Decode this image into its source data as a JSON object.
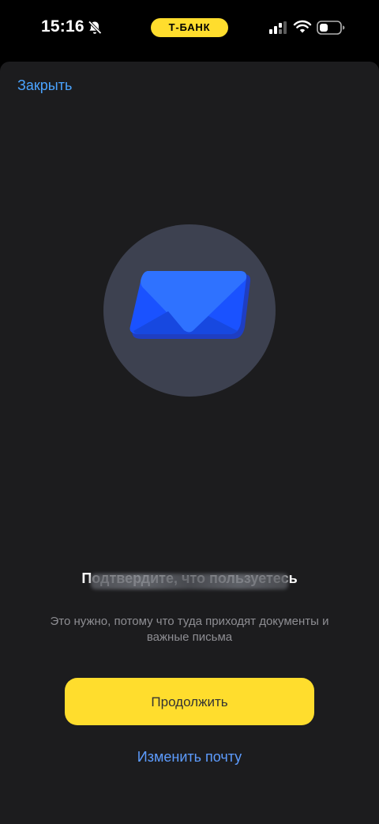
{
  "status_bar": {
    "time": "15:16",
    "carrier": "Т-БАНК",
    "icons": [
      "bell-slash-icon",
      "signal-icon",
      "wifi-icon",
      "battery-icon"
    ],
    "carrier_color": "#ffdd2d"
  },
  "header": {
    "close_label": "Закрыть"
  },
  "illustration": {
    "icon": "envelope-icon",
    "circle_color": "#3d4150",
    "envelope_color": "#1a52ff"
  },
  "content": {
    "title": "Подтвердите, что пользуетесь",
    "subtitle": "Это нужно, потому что туда приходят документы и важные письма"
  },
  "actions": {
    "continue_label": "Продолжить",
    "change_email_label": "Изменить почту",
    "accent_color": "#ffdd2d",
    "link_color": "#5d9cff"
  }
}
